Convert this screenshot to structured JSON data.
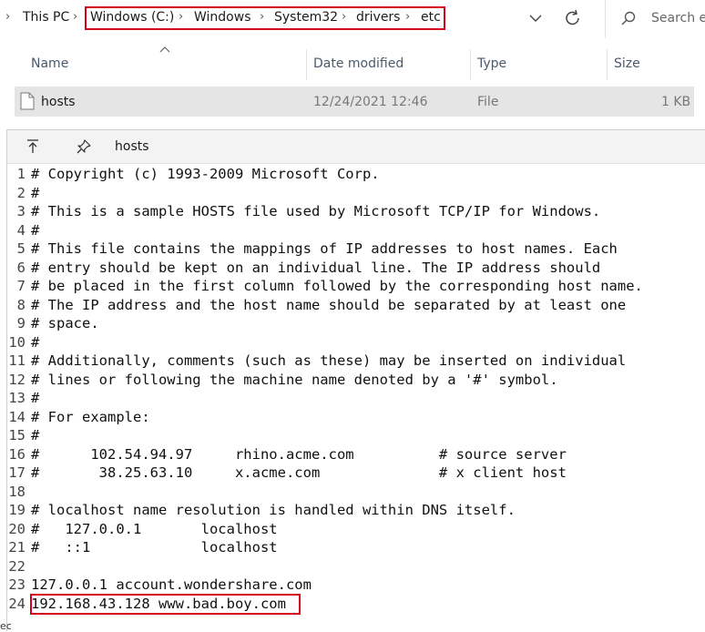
{
  "address_bar": {
    "crumbs": [
      "This PC",
      "Windows (C:)",
      "Windows",
      "System32",
      "drivers",
      "etc"
    ],
    "search_placeholder": "Search et"
  },
  "columns": {
    "name": "Name",
    "date_modified": "Date modified",
    "type": "Type",
    "size": "Size"
  },
  "file": {
    "name": "hosts",
    "date_modified": "12/24/2021 12:46",
    "type": "File",
    "size": "1 KB"
  },
  "notepad": {
    "title": "hosts",
    "lines": [
      {
        "n": "1",
        "text": "# Copyright (c) 1993-2009 Microsoft Corp."
      },
      {
        "n": "2",
        "text": "#"
      },
      {
        "n": "3",
        "text": "# This is a sample HOSTS file used by Microsoft TCP/IP for Windows."
      },
      {
        "n": "4",
        "text": "#"
      },
      {
        "n": "5",
        "text": "# This file contains the mappings of IP addresses to host names. Each"
      },
      {
        "n": "6",
        "text": "# entry should be kept on an individual line. The IP address should"
      },
      {
        "n": "7",
        "text": "# be placed in the first column followed by the corresponding host name."
      },
      {
        "n": "8",
        "text": "# The IP address and the host name should be separated by at least one"
      },
      {
        "n": "9",
        "text": "# space."
      },
      {
        "n": "10",
        "text": "#"
      },
      {
        "n": "11",
        "text": "# Additionally, comments (such as these) may be inserted on individual"
      },
      {
        "n": "12",
        "text": "# lines or following the machine name denoted by a '#' symbol."
      },
      {
        "n": "13",
        "text": "#"
      },
      {
        "n": "14",
        "text": "# For example:"
      },
      {
        "n": "15",
        "text": "#"
      },
      {
        "n": "16",
        "text": "#      102.54.94.97     rhino.acme.com          # source server"
      },
      {
        "n": "17",
        "text": "#       38.25.63.10     x.acme.com              # x client host"
      },
      {
        "n": "18",
        "text": ""
      },
      {
        "n": "19",
        "text": "# localhost name resolution is handled within DNS itself."
      },
      {
        "n": "20",
        "text": "#   127.0.0.1       localhost"
      },
      {
        "n": "21",
        "text": "#   ::1             localhost"
      },
      {
        "n": "22",
        "text": ""
      },
      {
        "n": "23",
        "text": "127.0.0.1 account.wondershare.com"
      },
      {
        "n": "24",
        "text": "192.168.43.128 www.bad.boy.com"
      }
    ]
  },
  "edge_text": "ec",
  "colors": {
    "highlight": "#d6001c",
    "selected_row": "#e5e5e5"
  }
}
